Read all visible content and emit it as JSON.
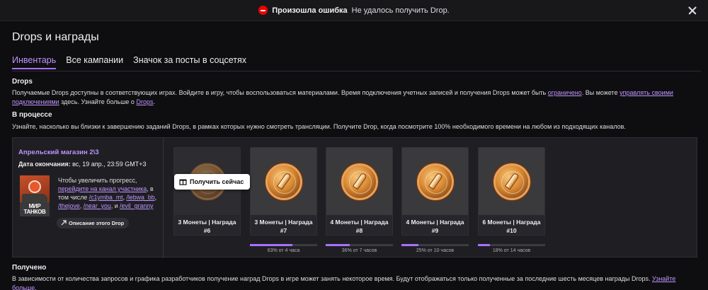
{
  "banner": {
    "title": "Произошла ошибка",
    "message": "Не удалось получить Drop.",
    "error_color": "#eb0400"
  },
  "page": {
    "title": "Drops и награды"
  },
  "tabs": [
    {
      "label": "Инвентарь",
      "active": true
    },
    {
      "label": "Все кампании",
      "active": false
    },
    {
      "label": "Значок за посты в соцсетях",
      "active": false
    }
  ],
  "drops_section": {
    "heading": "Drops",
    "text1": "Получаемые Drops доступны в соответствующих играх. Войдите в игру, чтобы воспользоваться материалами. Время подключения учетных записей и получения Drops может быть ",
    "link1": "ограничено",
    "text2": ". Вы можете ",
    "link2": "управлять своими подключениями",
    "text3": " здесь. Узнайте больше о ",
    "link3": "Drops",
    "text4": "."
  },
  "in_progress": {
    "heading": "В процессе",
    "text": "Узнайте, насколько вы близки к завершению заданий Drops, в рамках которых нужно смотреть трансляции. Получите Drop, когда посмотрите 100% необходимого времени на любом из подходящих каналов."
  },
  "campaign": {
    "name": "Апрельский магазин 2\\3",
    "end_label": "Дата окончания:",
    "end_value": " вс, 19 апр., 23:59 GMT+3",
    "game_label": "МИР ТАНКОВ",
    "text1": "Чтобы увеличить прогресс, ",
    "link_channel": "перейдите на канал участника",
    "text2": ", в том числе ",
    "ch1": "/c1ymba_mt",
    "sep1": ", ",
    "ch2": "/lebwa_bb",
    "sep2": ", ",
    "ch3": "/thejove",
    "sep3": ", ",
    "ch4": "/near_you",
    "sep4": ", и ",
    "ch5": "/evil_granny",
    "description_button": "Описание этого Drop",
    "claim_button": "Получить сейчас",
    "accent_color": "#a970ff",
    "rewards": [
      {
        "name": "3 Монеты | Награда #6",
        "progress_pct": 100,
        "progress_label": "",
        "claimable": true
      },
      {
        "name": "3 Монеты | Награда #7",
        "progress_pct": 63,
        "progress_label": "63% от 4 часа",
        "claimable": false
      },
      {
        "name": "4 Монеты | Награда #8",
        "progress_pct": 36,
        "progress_label": "36% от 7 часов",
        "claimable": false
      },
      {
        "name": "4 Монеты | Награда #9",
        "progress_pct": 25,
        "progress_label": "25% от 10 часов",
        "claimable": false
      },
      {
        "name": "6 Монеты | Награда #10",
        "progress_pct": 18,
        "progress_label": "18% от 14 часов",
        "claimable": false
      }
    ]
  },
  "received": {
    "heading": "Получено",
    "text": "В зависимости от количества запросов и графика разработчиков получение наград Drops в игре может занять некоторое время. Будут отображаться только полученные за последние шесть месяцев награды Drops. ",
    "link": "Узнайте больше",
    "text_end": "."
  }
}
